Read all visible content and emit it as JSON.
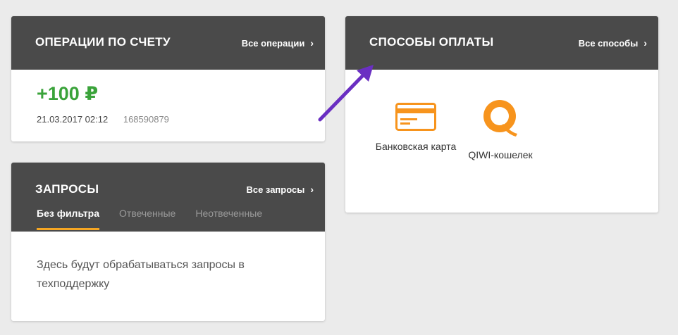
{
  "operations": {
    "title": "ОПЕРАЦИИ ПО СЧЕТУ",
    "all_link": "Все операции",
    "amount": "+100 ₽",
    "datetime": "21.03.2017 02:12",
    "op_id": "168590879"
  },
  "requests": {
    "title": "ЗАПРОСЫ",
    "all_link": "Все запросы",
    "tabs": [
      "Без фильтра",
      "Отвеченные",
      "Неотвеченные"
    ],
    "empty_text": "Здесь будут обрабатываться запросы в техподдержку"
  },
  "payment": {
    "title": "СПОСОБЫ ОПЛАТЫ",
    "all_link": "Все способы",
    "methods": [
      {
        "label": "Банковская карта",
        "icon": "credit-card-icon"
      },
      {
        "label": "QIWI-кошелек",
        "icon": "qiwi-icon"
      }
    ]
  },
  "colors": {
    "header_bg": "#4a4a4a",
    "accent": "#f5a623",
    "amount_green": "#3aa33a",
    "icon_orange": "#f7941d",
    "arrow_purple": "#6a2fc2"
  }
}
